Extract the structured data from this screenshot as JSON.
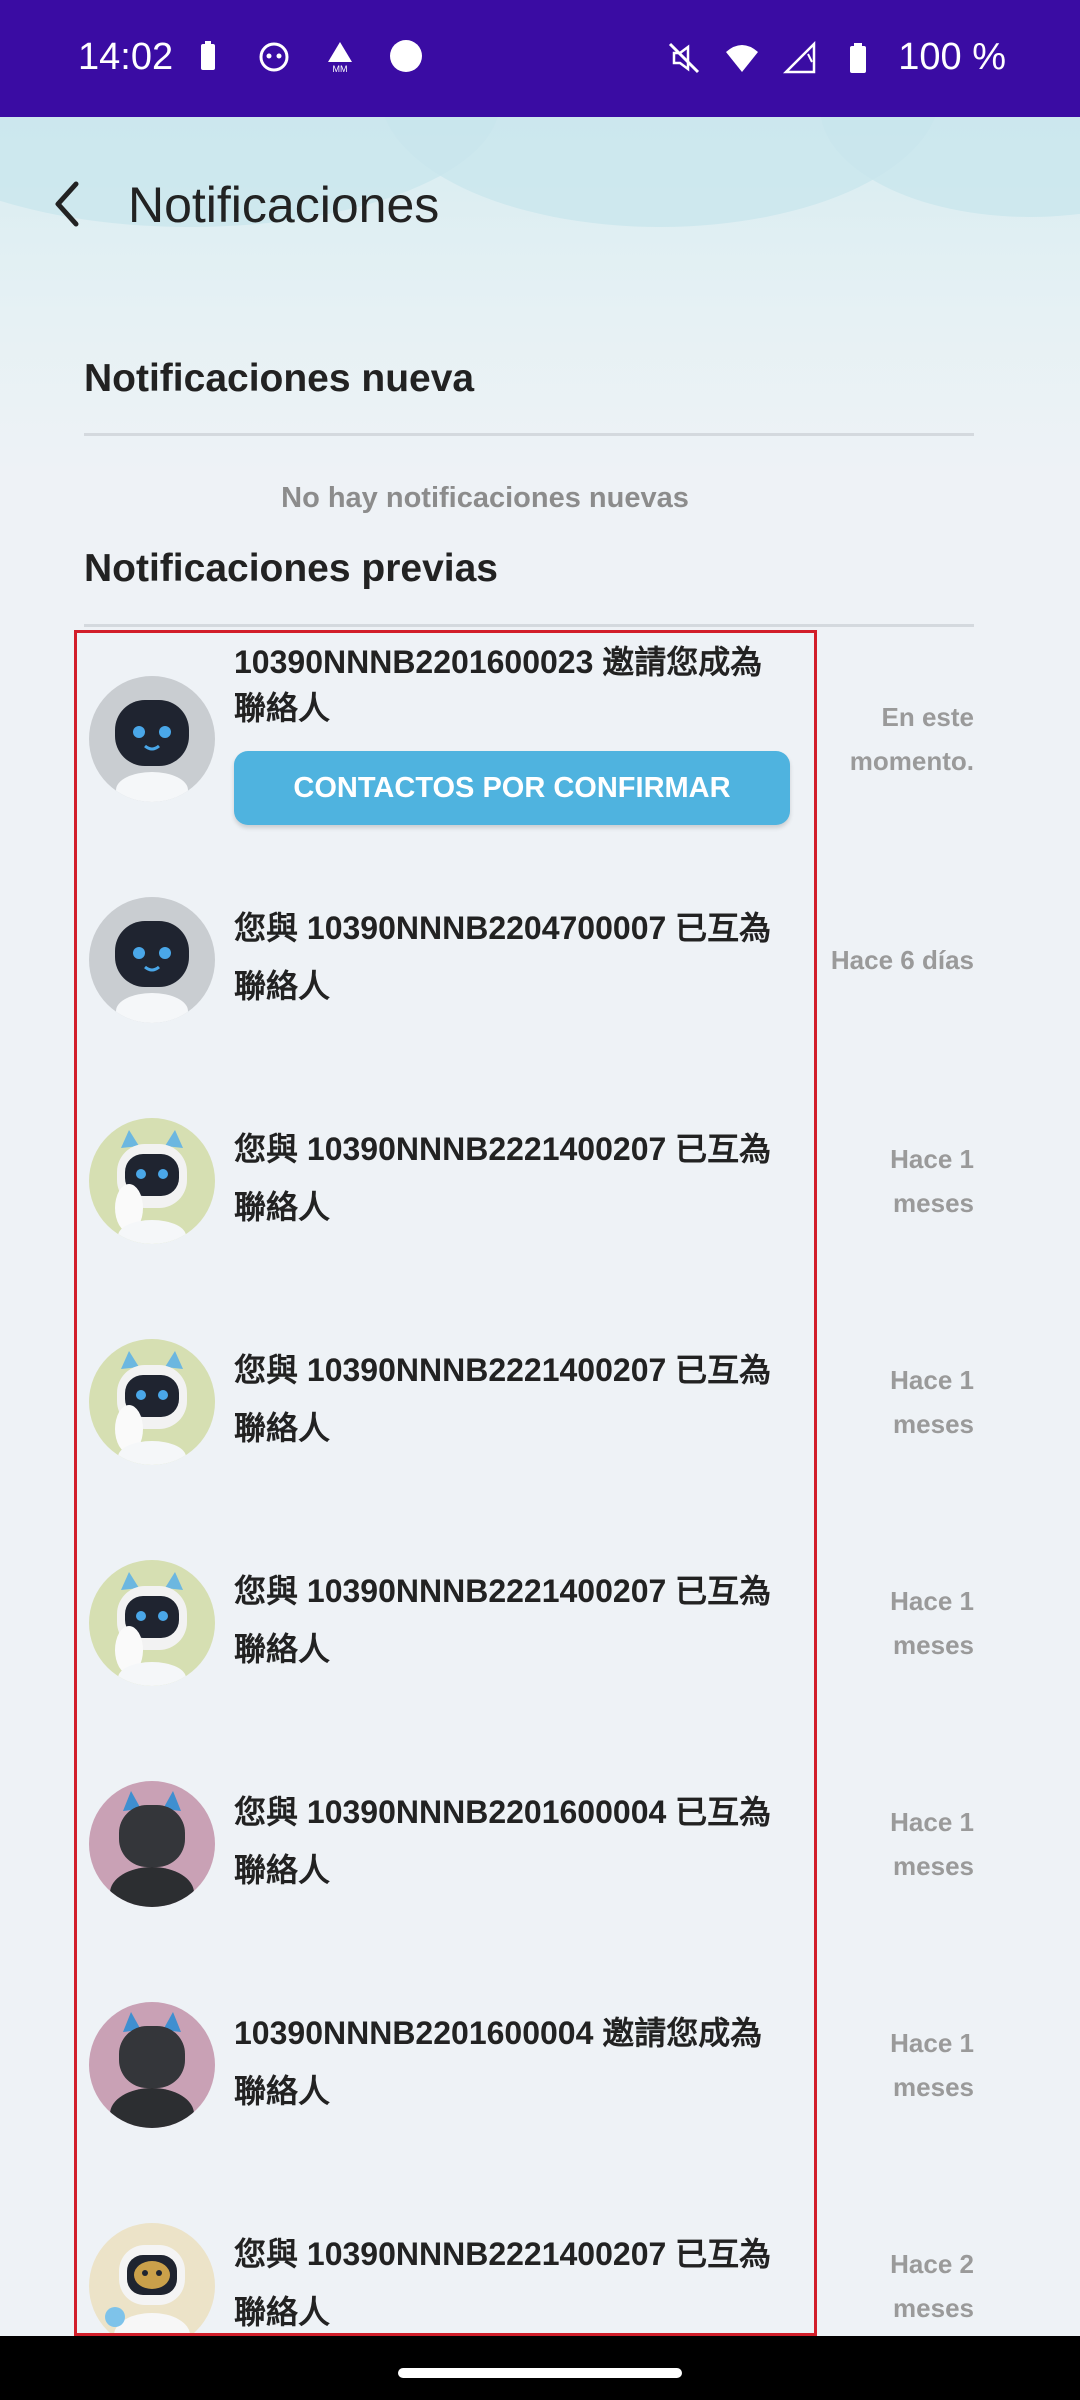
{
  "status_bar": {
    "time": "14:02",
    "battery_text": "100 %",
    "left_icons": [
      "battery-icon",
      "app-icon",
      "mm-icon",
      "circle-icon"
    ],
    "right_icons": [
      "mute-icon",
      "wifi-icon",
      "signal-icon",
      "battery-icon"
    ]
  },
  "header": {
    "title": "Notificaciones",
    "back_icon": "back-arrow-icon"
  },
  "sections": {
    "new_title": "Notificaciones nueva",
    "new_empty": "No hay notificaciones nuevas",
    "previous_title": "Notificaciones previas"
  },
  "notifications": [
    {
      "line1": "10390NNNB2201600023 邀請您成為",
      "line2": "聯絡人",
      "time1": "En este",
      "time2": "momento.",
      "button": "CONTACTOS POR CONFIRMAR",
      "avatar": "robot-black-grey"
    },
    {
      "line1": "您與 10390NNNB2204700007 已互為",
      "line2": "聯絡人",
      "time1": "Hace 6 días",
      "time2": "",
      "avatar": "robot-black-grey"
    },
    {
      "line1": "您與 10390NNNB2221400207 已互為",
      "line2": "聯絡人",
      "time1": "Hace 1",
      "time2": "meses",
      "avatar": "robot-cat-green"
    },
    {
      "line1": "您與 10390NNNB2221400207 已互為",
      "line2": "聯絡人",
      "time1": "Hace 1",
      "time2": "meses",
      "avatar": "robot-cat-green"
    },
    {
      "line1": "您與 10390NNNB2221400207 已互為",
      "line2": "聯絡人",
      "time1": "Hace 1",
      "time2": "meses",
      "avatar": "robot-cat-green"
    },
    {
      "line1": "您與 10390NNNB2201600004 已互為",
      "line2": "聯絡人",
      "time1": "Hace 1",
      "time2": "meses",
      "avatar": "robot-dark-pink"
    },
    {
      "line1": "10390NNNB2201600004 邀請您成為",
      "line2": "聯絡人",
      "time1": "Hace 1",
      "time2": "meses",
      "avatar": "robot-dark-pink"
    },
    {
      "line1": "您與 10390NNNB2221400207 已互為",
      "line2": "聯絡人",
      "time1": "Hace 2",
      "time2": "meses",
      "avatar": "robot-yellow-cream"
    }
  ],
  "colors": {
    "status_bar": "#3a0ca3",
    "button": "#4fb3df",
    "highlight_frame": "#d21e2a"
  }
}
